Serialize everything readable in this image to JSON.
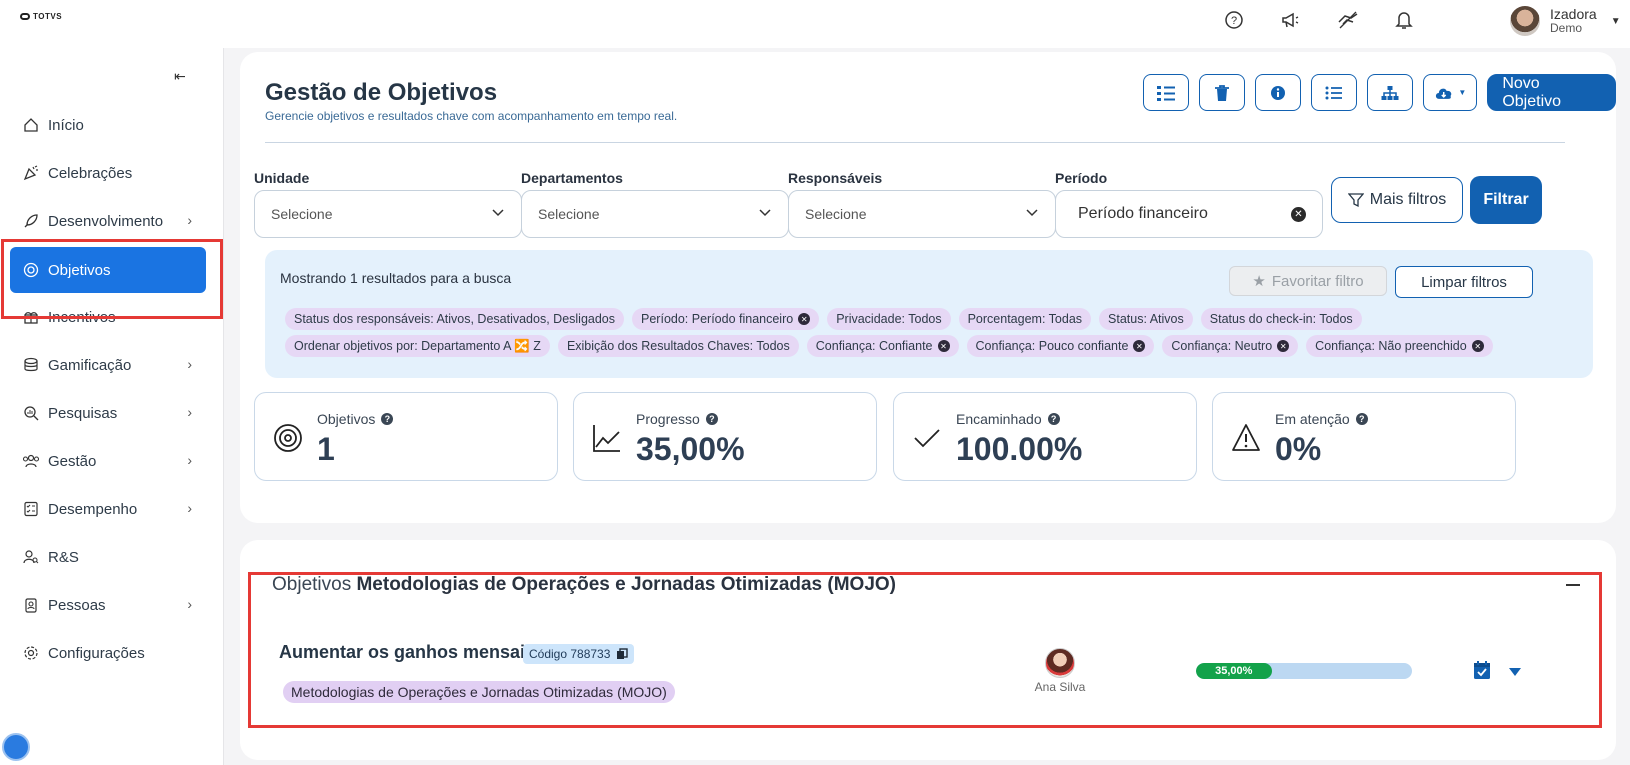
{
  "brand": {
    "logo_text": "TOTVS"
  },
  "topbar": {
    "icons": [
      "help-icon",
      "megaphone-icon",
      "hand-icon",
      "bell-icon"
    ],
    "user": {
      "name": "Izadora",
      "subtitle": "Demo"
    }
  },
  "sidebar": {
    "items": [
      {
        "label": "Início",
        "icon": "home-icon",
        "has_children": false
      },
      {
        "label": "Celebrações",
        "icon": "party-icon",
        "has_children": false
      },
      {
        "label": "Desenvolvimento",
        "icon": "rocket-icon",
        "has_children": true
      },
      {
        "label": "Objetivos",
        "icon": "target-icon",
        "has_children": false,
        "active": true
      },
      {
        "label": "Incentivos",
        "icon": "gift-icon",
        "has_children": false
      },
      {
        "label": "Gamificação",
        "icon": "coins-icon",
        "has_children": true
      },
      {
        "label": "Pesquisas",
        "icon": "search-chart-icon",
        "has_children": true
      },
      {
        "label": "Gestão",
        "icon": "team-icon",
        "has_children": true
      },
      {
        "label": "Desempenho",
        "icon": "checklist-icon",
        "has_children": true
      },
      {
        "label": "R&S",
        "icon": "user-search-icon",
        "has_children": false
      },
      {
        "label": "Pessoas",
        "icon": "badge-icon",
        "has_children": true
      },
      {
        "label": "Configurações",
        "icon": "gear-icon",
        "has_children": false
      }
    ]
  },
  "header": {
    "title": "Gestão de Objetivos",
    "subtitle": "Gerencie objetivos e resultados chave com acompanhamento em tempo real.",
    "new_button": "Novo Objetivo"
  },
  "filters": {
    "unit": {
      "label": "Unidade",
      "value": "Selecione"
    },
    "departments": {
      "label": "Departamentos",
      "value": "Selecione"
    },
    "owners": {
      "label": "Responsáveis",
      "value": "Selecione"
    },
    "period": {
      "label": "Período",
      "value": "Período financeiro"
    },
    "more_filters": "Mais filtros",
    "apply": "Filtrar"
  },
  "results": {
    "summary": "Mostrando 1 resultados para a busca",
    "favorite_button": "Favoritar filtro",
    "clear_button": "Limpar filtros",
    "chips_row1": [
      {
        "text": "Status dos responsáveis: Ativos, Desativados, Desligados",
        "removable": false
      },
      {
        "text": "Período: Período financeiro",
        "removable": true
      },
      {
        "text": "Privacidade: Todos",
        "removable": false
      },
      {
        "text": "Porcentagem: Todas",
        "removable": false
      },
      {
        "text": "Status: Ativos",
        "removable": false
      },
      {
        "text": "Status do check-in: Todos",
        "removable": false
      }
    ],
    "chips_row2": [
      {
        "text": "Ordenar objetivos por: Departamento A 🔀 Z",
        "removable": false
      },
      {
        "text": "Exibição dos Resultados Chaves: Todos",
        "removable": false
      },
      {
        "text": "Confiança: Confiante",
        "removable": true
      },
      {
        "text": "Confiança: Pouco confiante",
        "removable": true
      },
      {
        "text": "Confiança: Neutro",
        "removable": true
      },
      {
        "text": "Confiança: Não preenchido",
        "removable": true
      }
    ]
  },
  "stats": [
    {
      "label": "Objetivos",
      "value": "1",
      "icon": "target-icon"
    },
    {
      "label": "Progresso",
      "value": "35,00%",
      "icon": "line-chart-icon"
    },
    {
      "label": "Encaminhado",
      "value": "100.00%",
      "icon": "check-icon"
    },
    {
      "label": "Em atenção",
      "value": "0%",
      "icon": "warning-icon"
    }
  ],
  "objectives_section": {
    "prefix": "Objetivos",
    "group": "Metodologias de Operações e Jornadas Otimizadas (MOJO)",
    "items": [
      {
        "title": "Aumentar os ganhos mensais",
        "code": "Código 788733",
        "tag": "Metodologias de Operações e Jornadas Otimizadas (MOJO)",
        "owner": "Ana Silva",
        "progress_label": "35,00%",
        "progress": 0.35
      }
    ]
  },
  "colors": {
    "primary": "#1261b1",
    "active_nav": "#1a74e2",
    "progress": "#13a24a",
    "highlight": "#e53935"
  }
}
